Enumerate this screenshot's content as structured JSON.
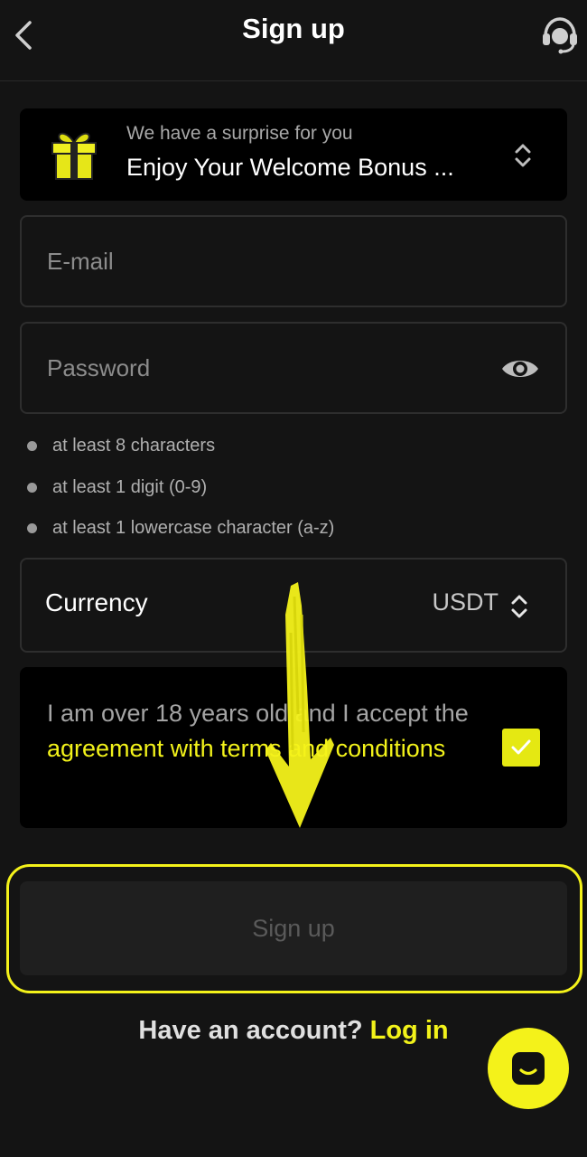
{
  "header": {
    "title": "Sign up",
    "back_icon": "chevron-left-icon",
    "support_icon": "headset-icon"
  },
  "bonus": {
    "subtitle": "We have a surprise for you",
    "title": "Enjoy Your Welcome Bonus ...",
    "icon": "gift-icon"
  },
  "form": {
    "email_placeholder": "E-mail",
    "password_placeholder": "Password"
  },
  "password_rules": [
    "at least 8 characters",
    "at least 1 digit (0-9)",
    "at least 1 lowercase character (a-z)"
  ],
  "currency": {
    "label": "Currency",
    "value": "USDT"
  },
  "terms": {
    "text_before": "I am over 18 years old and I accept the ",
    "link": "agreement with terms and conditions",
    "checked": true
  },
  "signup_button": "Sign up",
  "account": {
    "question": "Have an account? ",
    "login_link": "Log in"
  },
  "colors": {
    "accent": "#f2f21a",
    "background": "#141414",
    "panel": "#000000"
  }
}
